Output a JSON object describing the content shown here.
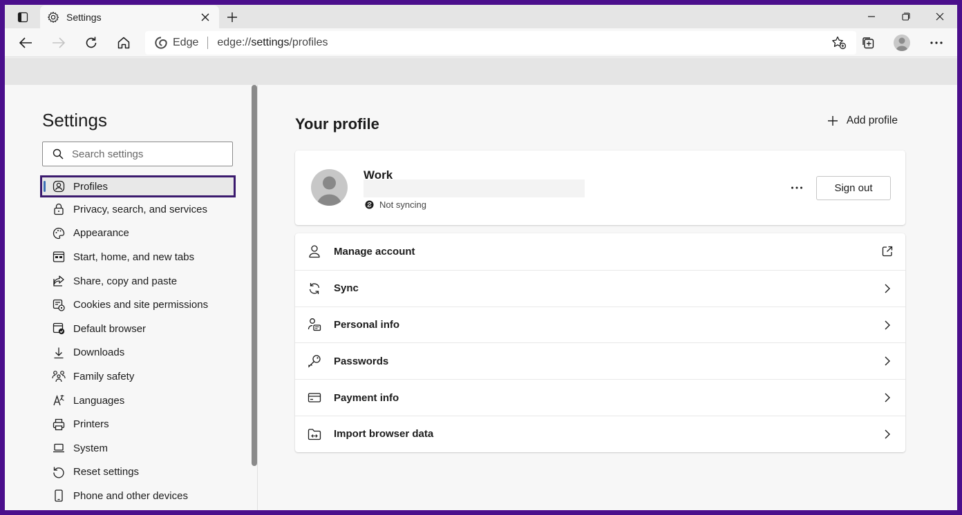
{
  "browser": {
    "tab": {
      "title": "Settings"
    },
    "address": {
      "brand": "Edge",
      "url_prefix": "edge://",
      "url_host": "settings",
      "url_path": "/profiles"
    }
  },
  "sidebar": {
    "title": "Settings",
    "search_placeholder": "Search settings",
    "items": [
      {
        "label": "Profiles",
        "icon": "profile-icon",
        "active": true
      },
      {
        "label": "Privacy, search, and services",
        "icon": "lock-icon"
      },
      {
        "label": "Appearance",
        "icon": "palette-icon"
      },
      {
        "label": "Start, home, and new tabs",
        "icon": "start-page-icon"
      },
      {
        "label": "Share, copy and paste",
        "icon": "share-icon"
      },
      {
        "label": "Cookies and site permissions",
        "icon": "cookies-icon"
      },
      {
        "label": "Default browser",
        "icon": "default-browser-icon"
      },
      {
        "label": "Downloads",
        "icon": "download-icon"
      },
      {
        "label": "Family safety",
        "icon": "family-icon"
      },
      {
        "label": "Languages",
        "icon": "languages-icon"
      },
      {
        "label": "Printers",
        "icon": "printer-icon"
      },
      {
        "label": "System",
        "icon": "laptop-icon"
      },
      {
        "label": "Reset settings",
        "icon": "reset-icon"
      },
      {
        "label": "Phone and other devices",
        "icon": "phone-icon"
      }
    ]
  },
  "main": {
    "title": "Your profile",
    "add_profile_label": "Add profile",
    "profile": {
      "name": "Work",
      "sync_status": "Not syncing",
      "sign_out_label": "Sign out"
    },
    "rows": [
      {
        "label": "Manage account",
        "icon": "person-icon",
        "trailing": "external-link-icon"
      },
      {
        "label": "Sync",
        "icon": "sync-icon",
        "trailing": "chevron-right-icon"
      },
      {
        "label": "Personal info",
        "icon": "personal-info-icon",
        "trailing": "chevron-right-icon"
      },
      {
        "label": "Passwords",
        "icon": "key-icon",
        "trailing": "chevron-right-icon"
      },
      {
        "label": "Payment info",
        "icon": "card-icon",
        "trailing": "chevron-right-icon"
      },
      {
        "label": "Import browser data",
        "icon": "import-icon",
        "trailing": "chevron-right-icon"
      }
    ]
  }
}
